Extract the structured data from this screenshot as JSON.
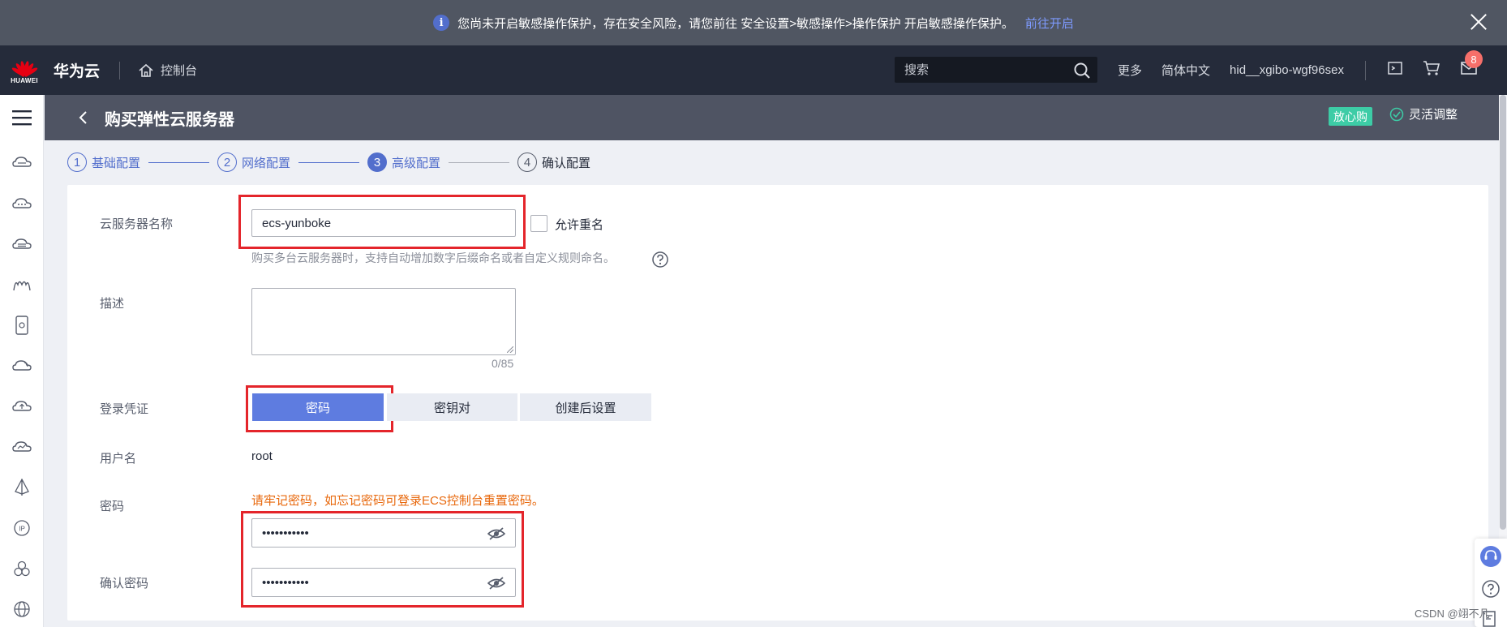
{
  "notice": {
    "text": "您尚未开启敏感操作保护，存在安全风险，请您前往 安全设置>敏感操作>操作保护 开启敏感操作保护。",
    "link": "前往开启",
    "info_glyph": "i"
  },
  "header": {
    "logo_text": "HUAWEI",
    "brand": "华为云",
    "console": "控制台",
    "search_placeholder": "搜索",
    "more": "更多",
    "language": "简体中文",
    "username": "hid__xgibo-wgf96sex",
    "message_count": "8"
  },
  "page": {
    "title": "购买弹性云服务器",
    "badge": "放心购",
    "flex_adjust": "灵活调整"
  },
  "steps": [
    {
      "num": "1",
      "label": "基础配置"
    },
    {
      "num": "2",
      "label": "网络配置"
    },
    {
      "num": "3",
      "label": "高级配置"
    },
    {
      "num": "4",
      "label": "确认配置"
    }
  ],
  "form": {
    "name_label": "云服务器名称",
    "name_value": "ecs-yunboke",
    "allow_dup_label": "允许重名",
    "name_hint": "购买多台云服务器时，支持自动增加数字后缀命名或者自定义规则命名。",
    "desc_label": "描述",
    "desc_counter": "0/85",
    "login_label": "登录凭证",
    "login_options": [
      "密码",
      "密钥对",
      "创建后设置"
    ],
    "username_label": "用户名",
    "username_value": "root",
    "password_label": "密码",
    "password_warning": "请牢记密码，如忘记密码可登录ECS控制台重置密码。",
    "password_mask": "•••••••••••",
    "confirm_label": "确认密码",
    "confirm_mask": "•••••••••••"
  },
  "watermark": "CSDN @翊不凡",
  "colors": {
    "accent": "#526ecc",
    "highlight_box": "#e4252b",
    "warning": "#e8680c",
    "success": "#3dcca6"
  }
}
